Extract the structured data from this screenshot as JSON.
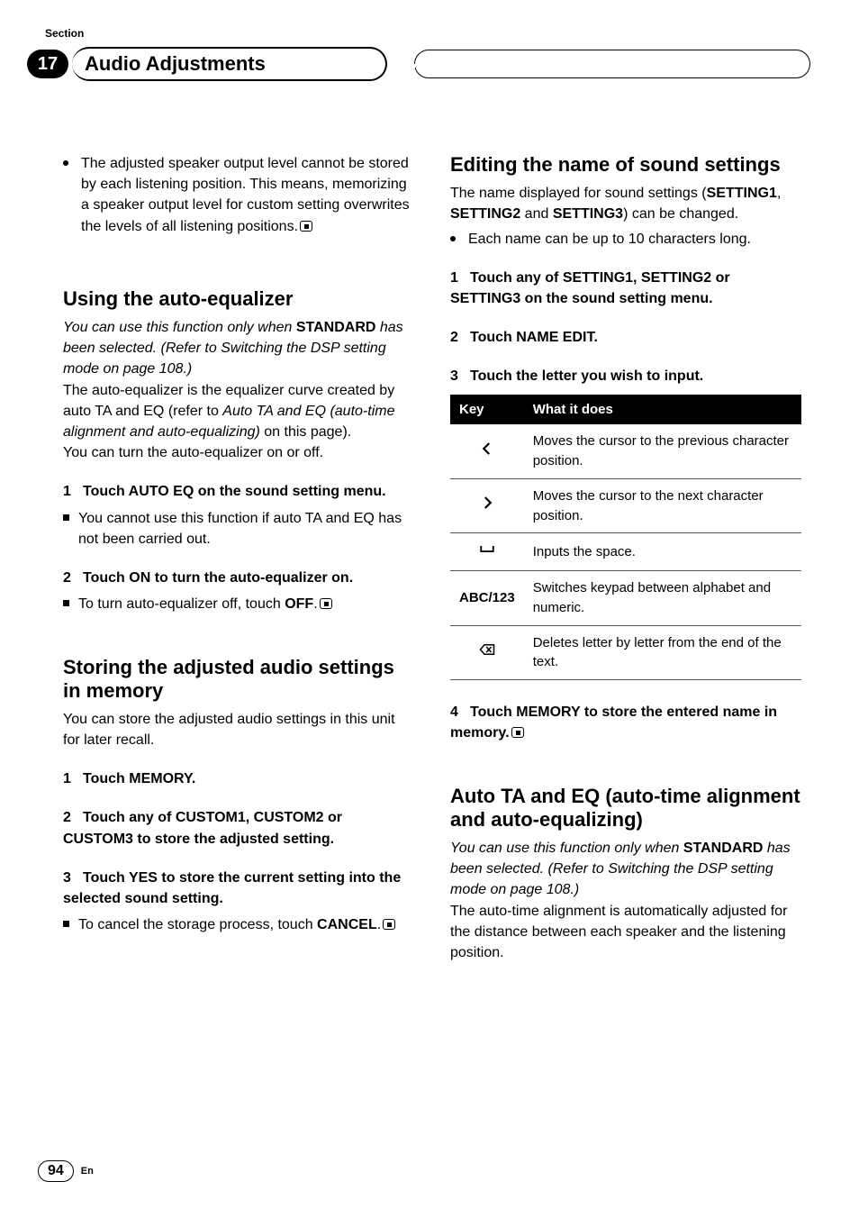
{
  "header": {
    "section_label": "Section",
    "section_number": "17",
    "title": "Audio Adjustments"
  },
  "left": {
    "top_bullet": "The adjusted speaker output level cannot be stored by each listening position. This means, memorizing a speaker output level for custom setting overwrites the levels of all listening positions.",
    "sec1_title": "Using the auto-equalizer",
    "sec1_p1_a": "You can use this function only when ",
    "sec1_p1_b": "STANDARD",
    "sec1_p1_c": " has been selected. (Refer to Switching the DSP setting mode on page 108.)",
    "sec1_p2_a": "The auto-equalizer is the equalizer curve created by auto TA and EQ (refer to ",
    "sec1_p2_b": "Auto TA and EQ (auto-time alignment and auto-equalizing)",
    "sec1_p2_c": " on this page).",
    "sec1_p3": "You can turn the auto-equalizer on or off.",
    "sec1_step1": "Touch AUTO EQ on the sound setting menu.",
    "sec1_step1_note": "You cannot use this function if auto TA and EQ has not been carried out.",
    "sec1_step2": "Touch ON to turn the auto-equalizer on.",
    "sec1_step2_note_a": "To turn auto-equalizer off, touch ",
    "sec1_step2_note_b": "OFF",
    "sec1_step2_note_c": ".",
    "sec2_title": "Storing the adjusted audio settings in memory",
    "sec2_p1": "You can store the adjusted audio settings in this unit for later recall.",
    "sec2_step1": "Touch MEMORY.",
    "sec2_step2": "Touch any of CUSTOM1, CUSTOM2 or CUSTOM3 to store the adjusted setting.",
    "sec2_step3": "Touch YES to store the current setting into the selected sound setting.",
    "sec2_step3_note_a": "To cancel the storage process, touch ",
    "sec2_step3_note_b": "CANCEL",
    "sec2_step3_note_c": "."
  },
  "right": {
    "sec3_title": "Editing the name of sound settings",
    "sec3_p1_a": "The name displayed for sound settings (",
    "sec3_p1_b": "SETTING1",
    "sec3_p1_c": ", ",
    "sec3_p1_d": "SETTING2",
    "sec3_p1_e": " and ",
    "sec3_p1_f": "SETTING3",
    "sec3_p1_g": ") can be changed.",
    "sec3_bullet": "Each name can be up to 10 characters long.",
    "sec3_step1": "Touch any of SETTING1, SETTING2 or SETTING3 on the sound setting menu.",
    "sec3_step2": "Touch NAME EDIT.",
    "sec3_step3": "Touch the letter you wish to input.",
    "table": {
      "head_key": "Key",
      "head_desc": "What it does",
      "rows": [
        {
          "key_icon": "left",
          "desc": "Moves the cursor to the previous character position."
        },
        {
          "key_icon": "right",
          "desc": "Moves the cursor to the next character position."
        },
        {
          "key_icon": "space",
          "desc": "Inputs the space."
        },
        {
          "key_text": "ABC/123",
          "desc": "Switches keypad between alphabet and numeric."
        },
        {
          "key_icon": "delete",
          "desc": "Deletes letter by letter from the end of the text."
        }
      ]
    },
    "sec3_step4": "Touch MEMORY to store the entered name in memory.",
    "sec4_title": "Auto TA and EQ (auto-time alignment and auto-equalizing)",
    "sec4_p1_a": "You can use this function only when ",
    "sec4_p1_b": "STANDARD",
    "sec4_p1_c": " has been selected. (Refer to Switching the DSP setting mode on page 108.)",
    "sec4_p2": "The auto-time alignment is automatically adjusted for the distance between each speaker and the listening position."
  },
  "footer": {
    "page_number": "94",
    "lang": "En"
  },
  "nums": {
    "n1": "1",
    "n2": "2",
    "n3": "3",
    "n4": "4"
  }
}
